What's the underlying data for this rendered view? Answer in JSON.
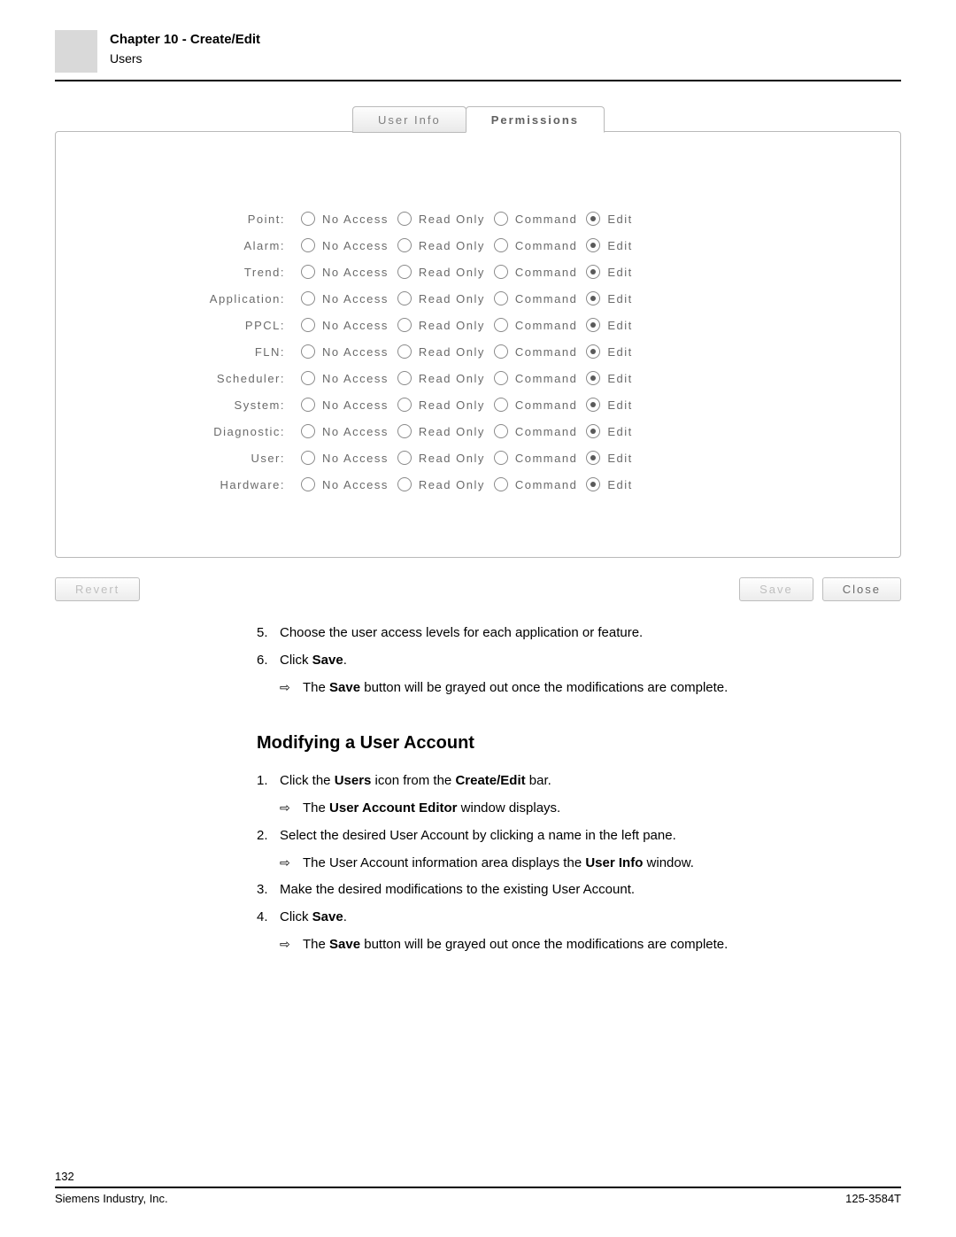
{
  "header": {
    "chapter": "Chapter 10 - Create/Edit",
    "sub": "Users"
  },
  "tabs": {
    "userinfo": "User Info",
    "permissions": "Permissions"
  },
  "perm_labels": {
    "na": "No Access",
    "ro": "Read Only",
    "cmd": "Command",
    "ed": "Edit"
  },
  "perm_rows": [
    {
      "key": "point",
      "label": "Point:"
    },
    {
      "key": "alarm",
      "label": "Alarm:"
    },
    {
      "key": "trend",
      "label": "Trend:"
    },
    {
      "key": "application",
      "label": "Application:"
    },
    {
      "key": "ppcl",
      "label": "PPCL:"
    },
    {
      "key": "fln",
      "label": "FLN:"
    },
    {
      "key": "scheduler",
      "label": "Scheduler:"
    },
    {
      "key": "system",
      "label": "System:"
    },
    {
      "key": "diagnostic",
      "label": "Diagnostic:"
    },
    {
      "key": "user",
      "label": "User:"
    },
    {
      "key": "hardware",
      "label": "Hardware:"
    }
  ],
  "buttons": {
    "revert": "Revert",
    "save": "Save",
    "close": "Close"
  },
  "prose": {
    "step5_num": "5.",
    "step5_txt": "Choose the user access levels for each application or feature.",
    "step6_num": "6.",
    "step6_pre": "Click ",
    "step6_bold": "Save",
    "step6_post": ".",
    "step6_sub_pre": "The ",
    "step6_sub_bold": "Save",
    "step6_sub_post": " button will be grayed out once the modifications are complete.",
    "heading": "Modifying a User Account",
    "m1_num": "1.",
    "m1_pre": "Click the ",
    "m1_b1": "Users",
    "m1_mid": " icon from the ",
    "m1_b2": "Create/Edit",
    "m1_post": " bar.",
    "m1_sub_pre": "The ",
    "m1_sub_bold": "User Account Editor",
    "m1_sub_post": " window displays.",
    "m2_num": "2.",
    "m2_txt": "Select the desired User Account by clicking a name in the left pane.",
    "m2_sub_pre": "The User Account information area displays the ",
    "m2_sub_bold": "User Info",
    "m2_sub_post": " window.",
    "m3_num": "3.",
    "m3_txt": "Make the desired modifications to the existing User Account.",
    "m4_num": "4.",
    "m4_pre": "Click ",
    "m4_bold": "Save",
    "m4_post": ".",
    "m4_sub_pre": "The ",
    "m4_sub_bold": "Save",
    "m4_sub_post": " button will be grayed out once the modifications are complete."
  },
  "footer": {
    "page": "132",
    "left": "Siemens Industry, Inc.",
    "right": "125-3584T"
  },
  "arrow": "⇨"
}
